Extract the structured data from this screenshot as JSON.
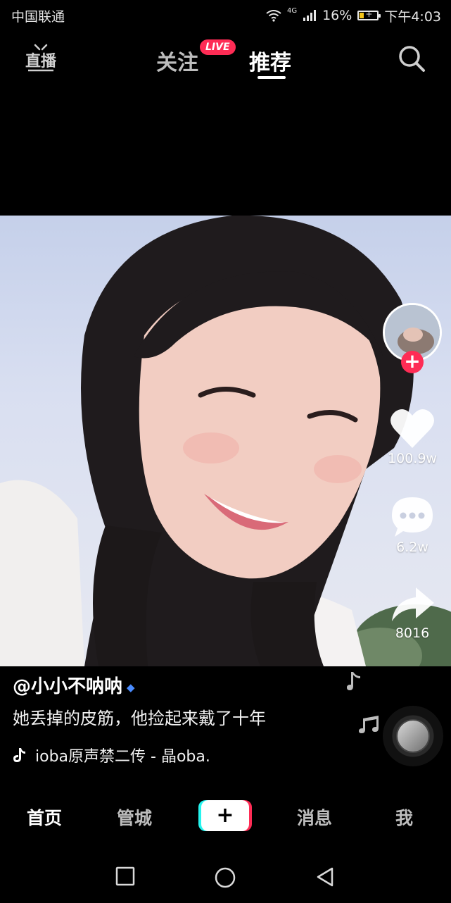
{
  "status_bar": {
    "carrier": "中国联通",
    "network": "4G",
    "battery": "16%",
    "time": "下午4:03"
  },
  "top_nav": {
    "live_icon": "live-tv-icon",
    "tabs": [
      {
        "label": "关注",
        "badge": "LIVE"
      },
      {
        "label": "推荐"
      }
    ],
    "search_icon": "search-icon"
  },
  "video": {
    "author": "@小小不呐呐",
    "caption": "她丢掉的皮筋，他捡起来戴了十年",
    "music": "ioba原声禁二传 - 晶oba."
  },
  "side_actions": {
    "follow": "+",
    "likes": "100.9w",
    "comments": "6.2w",
    "shares": "8016"
  },
  "bottom_nav": {
    "items": [
      "首页",
      "管城",
      "+",
      "消息",
      "我"
    ]
  },
  "colors": {
    "accent": "#fe2c55",
    "cyan": "#25f4ee",
    "verify": "#4a8cff"
  }
}
